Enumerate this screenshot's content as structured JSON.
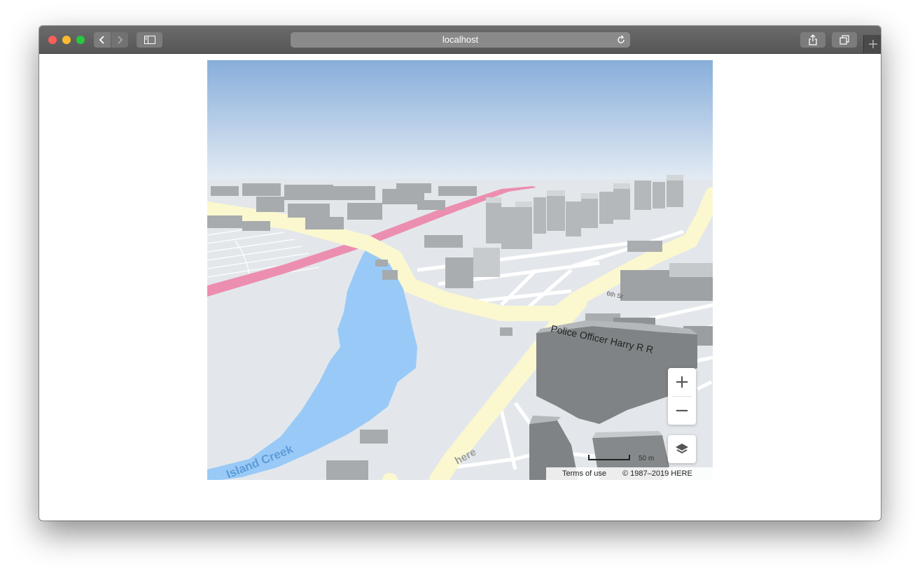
{
  "browser": {
    "address": "localhost",
    "controls": {
      "back": "chevron-left-icon",
      "forward": "chevron-right-icon",
      "sidebar": "sidebar-icon",
      "reload": "reload-icon",
      "share": "share-icon",
      "tabs": "tabs-icon",
      "new_tab": "plus-icon"
    }
  },
  "map": {
    "labels": {
      "creek": "Island Creek",
      "street": "Police Officer Harry R R",
      "partial_street": "here",
      "small_street": "6th St"
    },
    "controls": {
      "zoom_in": "+",
      "zoom_out": "−",
      "layers_icon": "layers-icon"
    },
    "scale": "50 m",
    "attribution": {
      "terms": "Terms of use",
      "copyright": "© 1987–2019 HERE"
    },
    "colors": {
      "sky_top": "#87aedb",
      "ground": "#e3e7eb",
      "water": "#99caf7",
      "major_road": "#fbf8cf",
      "highway": "#ec8eb0",
      "building": "#b1b5b7"
    }
  }
}
